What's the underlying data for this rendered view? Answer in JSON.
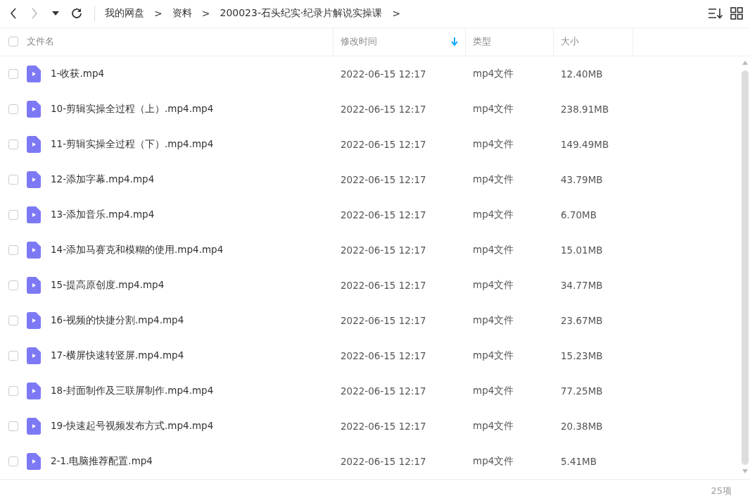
{
  "toolbar": {
    "breadcrumbs": [
      "我的网盘",
      "资料",
      "200023-石头纪实·纪录片解说实操课"
    ],
    "separator": ">"
  },
  "table": {
    "select_all": {
      "checked": false
    },
    "columns": [
      {
        "label": "文件名",
        "sorted": false
      },
      {
        "label": "修改时间",
        "sorted": true
      },
      {
        "label": "类型",
        "sorted": false
      },
      {
        "label": "大小",
        "sorted": false
      }
    ],
    "rows": [
      {
        "name": "1-收获.mp4",
        "modified": "2022-06-15 12:17",
        "type": "mp4文件",
        "size": "12.40MB",
        "checked": false
      },
      {
        "name": "10-剪辑实操全过程（上）.mp4.mp4",
        "modified": "2022-06-15 12:17",
        "type": "mp4文件",
        "size": "238.91MB",
        "checked": false
      },
      {
        "name": "11-剪辑实操全过程（下）.mp4.mp4",
        "modified": "2022-06-15 12:17",
        "type": "mp4文件",
        "size": "149.49MB",
        "checked": false
      },
      {
        "name": "12-添加字幕.mp4.mp4",
        "modified": "2022-06-15 12:17",
        "type": "mp4文件",
        "size": "43.79MB",
        "checked": false
      },
      {
        "name": "13-添加音乐.mp4.mp4",
        "modified": "2022-06-15 12:17",
        "type": "mp4文件",
        "size": "6.70MB",
        "checked": false
      },
      {
        "name": "14-添加马赛克和模糊的使用.mp4.mp4",
        "modified": "2022-06-15 12:17",
        "type": "mp4文件",
        "size": "15.01MB",
        "checked": false
      },
      {
        "name": "15-提高原创度.mp4.mp4",
        "modified": "2022-06-15 12:17",
        "type": "mp4文件",
        "size": "34.77MB",
        "checked": false
      },
      {
        "name": "16-视频的快捷分割.mp4.mp4",
        "modified": "2022-06-15 12:17",
        "type": "mp4文件",
        "size": "23.67MB",
        "checked": false
      },
      {
        "name": "17-横屏快速转竖屏.mp4.mp4",
        "modified": "2022-06-15 12:17",
        "type": "mp4文件",
        "size": "15.23MB",
        "checked": false
      },
      {
        "name": "18-封面制作及三联屏制作.mp4.mp4",
        "modified": "2022-06-15 12:17",
        "type": "mp4文件",
        "size": "77.25MB",
        "checked": false
      },
      {
        "name": "19-快速起号视频发布方式.mp4.mp4",
        "modified": "2022-06-15 12:17",
        "type": "mp4文件",
        "size": "20.38MB",
        "checked": false
      },
      {
        "name": "2-1.电脑推荐配置.mp4",
        "modified": "2022-06-15 12:17",
        "type": "mp4文件",
        "size": "5.41MB",
        "checked": false
      }
    ]
  },
  "status_bar": {
    "count": "25项"
  }
}
